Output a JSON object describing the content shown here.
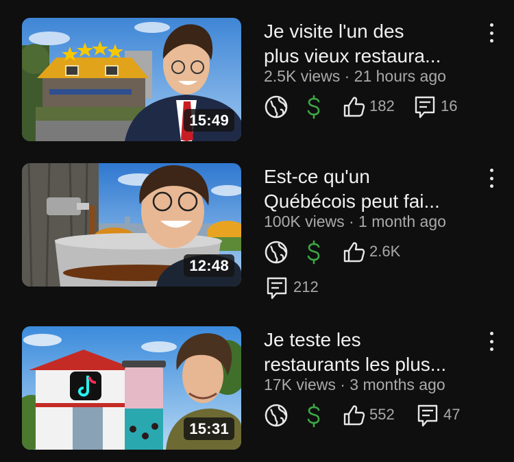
{
  "colors": {
    "background": "#0f0f0f",
    "title_text": "#f1f1f1",
    "meta_text": "#aaaaaa",
    "monetized_icon": "#3ea845",
    "icon_stroke": "#e8e8e8"
  },
  "videos": [
    {
      "duration": "15:49",
      "title_line1": "Je visite l'un des",
      "title_line2": "plus vieux restaura...",
      "meta": "2.5K views · 21 hours ago",
      "visibility_icon": "globe-icon",
      "monetization_icon": "dollar-icon",
      "likes": "182",
      "comments": "16"
    },
    {
      "duration": "12:48",
      "title_line1": "Est-ce qu'un",
      "title_line2": "Québécois peut fai...",
      "meta": "100K views · 1 month ago",
      "visibility_icon": "globe-icon",
      "monetization_icon": "dollar-icon",
      "likes": "2.6K",
      "comments": "212"
    },
    {
      "duration": "15:31",
      "title_line1": "Je teste les",
      "title_line2": "restaurants les plus...",
      "meta": "17K views · 3 months ago",
      "visibility_icon": "globe-icon",
      "monetization_icon": "dollar-icon",
      "likes": "552",
      "comments": "47"
    }
  ]
}
